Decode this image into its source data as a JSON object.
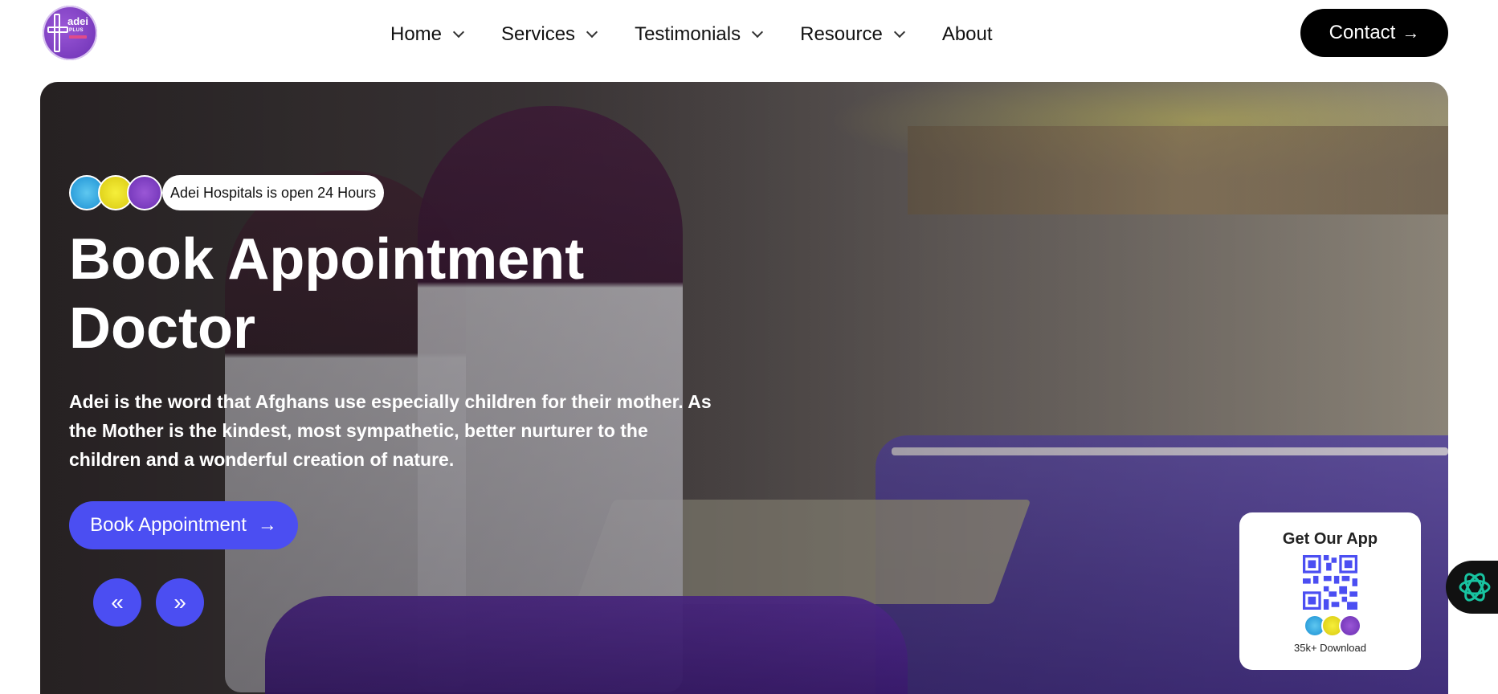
{
  "header": {
    "logo": {
      "text": "adei",
      "sub": "PLUS"
    },
    "nav": [
      {
        "label": "Home",
        "has_dropdown": true
      },
      {
        "label": "Services",
        "has_dropdown": true
      },
      {
        "label": "Testimonials",
        "has_dropdown": true
      },
      {
        "label": "Resource",
        "has_dropdown": true
      },
      {
        "label": "About",
        "has_dropdown": false
      }
    ],
    "contact_label": "Contact"
  },
  "hero": {
    "badge": "Adei Hospitals is open 24 Hours",
    "title_line1": "Book Appointment",
    "title_line2": "Doctor",
    "description_line1": "Adei is the word that Afghans use especially children for their mother. As",
    "description_line2": "the Mother is the kindest, most sympathetic, better nurturer to the",
    "description_line3": "children and a wonderful creation of nature.",
    "cta_label": "Book Appointment",
    "prev_label": "«",
    "next_label": "»"
  },
  "app_card": {
    "title": "Get Our App",
    "downloads": "35k+ Download"
  },
  "colors": {
    "accent": "#4b4ef2",
    "brand_purple": "#7a3fc4",
    "contact_bg": "#000000"
  },
  "icons": {
    "arrow": "right-arrow-icon",
    "chevron": "chevron-down-icon",
    "widget": "openai-icon"
  }
}
